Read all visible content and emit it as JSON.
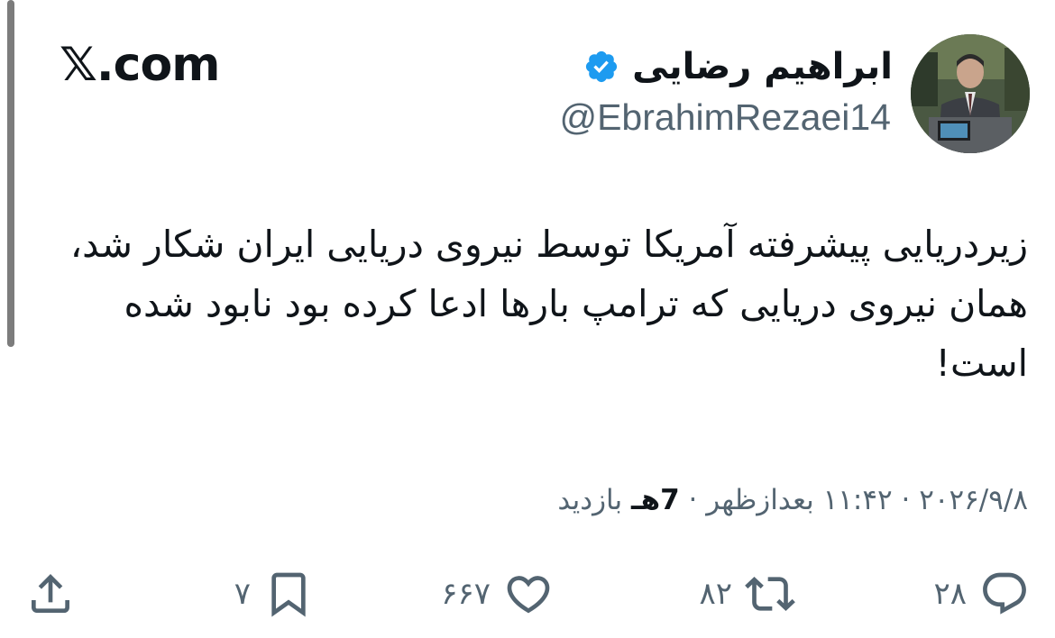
{
  "brand": "𝕏.com",
  "author": {
    "display_name": "ابراهیم رضایی",
    "handle": "@EbrahimRezaei14",
    "verified": true
  },
  "tweet": {
    "text": "زیردریایی پیشرفته آمریکا توسط نیروی دریایی ایران شکار شد، همان نیروی دریایی که ترامپ بارها ادعا کرده بود نابود شده است!"
  },
  "meta": {
    "date": "۲۰۲۶/۹/۸",
    "separator": "·",
    "time": "۱۱:۴۲ بعدازظهر",
    "views_count": "7هـ",
    "views_label": "بازدید"
  },
  "actions": {
    "reply_count": "۲۸",
    "retweet_count": "۸۲",
    "like_count": "۶۶۷",
    "bookmark_count": "۷"
  },
  "colors": {
    "text": "#0f1419",
    "muted": "#536471",
    "verified": "#1d9bf0"
  },
  "icons": {
    "reply": "reply-icon",
    "retweet": "retweet-icon",
    "like": "heart-icon",
    "bookmark": "bookmark-icon",
    "share": "share-icon",
    "verified": "verified-badge-icon"
  }
}
